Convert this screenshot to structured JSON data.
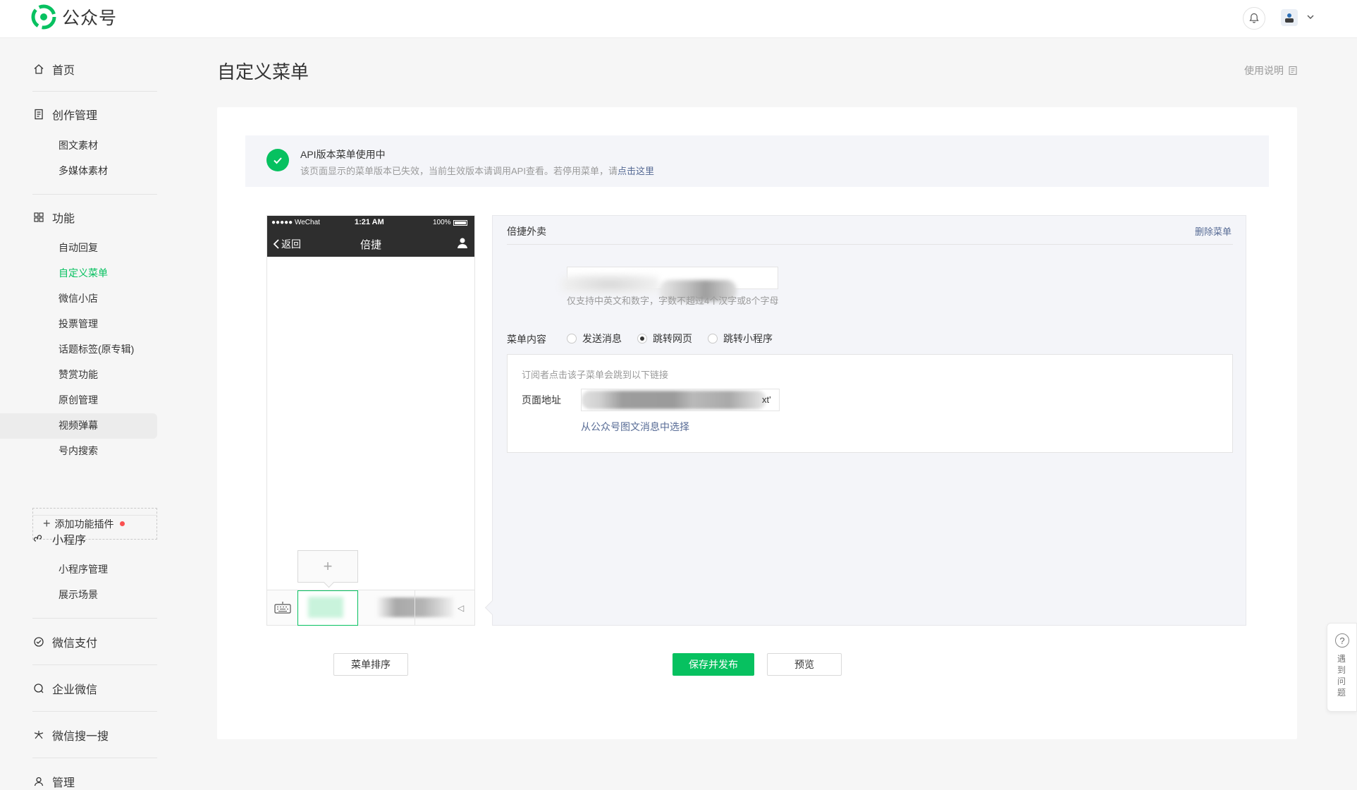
{
  "app": {
    "brand": "公众号"
  },
  "sidebar": {
    "home": "首页",
    "creation": {
      "label": "创作管理",
      "items": [
        "图文素材",
        "多媒体素材"
      ]
    },
    "functions": {
      "label": "功能",
      "items": [
        "自动回复",
        "自定义菜单",
        "微信小店",
        "投票管理",
        "话题标签(原专辑)",
        "赞赏功能",
        "原创管理",
        "视频弹幕",
        "号内搜索"
      ],
      "active_index": 1
    },
    "add_plugin": "添加功能插件",
    "miniprogram": {
      "label": "小程序",
      "items": [
        "小程序管理",
        "展示场景"
      ]
    },
    "pay": "微信支付",
    "work": "企业微信",
    "search": "微信搜一搜",
    "manage": "管理"
  },
  "main": {
    "title": "自定义菜单",
    "help": "使用说明",
    "notice": {
      "title": "API版本菜单使用中",
      "desc": "该页面显示的菜单版本已失效，当前生效版本请调用API查看。若停用菜单，请",
      "link": "点击这里"
    },
    "phone": {
      "signal": "●●●●● WeChat",
      "time": "1:21 AM",
      "battery": "100%",
      "back": "返回",
      "title": "倍捷",
      "add_symbol": "+"
    },
    "editor": {
      "menu_name": "倍捷外卖",
      "delete": "删除菜单",
      "name_hint": "仅支持中英文和数字，字数不超过4个汉字或8个字母",
      "content_label": "菜单内容",
      "options": [
        "发送消息",
        "跳转网页",
        "跳转小程序"
      ],
      "selected_option": "跳转网页",
      "url_desc": "订阅者点击该子菜单会跳到以下链接",
      "url_label": "页面地址",
      "url_tail": "xt'",
      "url_pick": "从公众号图文消息中选择"
    },
    "buttons": {
      "sort": "菜单排序",
      "save": "保存并发布",
      "preview": "预览"
    }
  },
  "float_help": {
    "symbol": "?",
    "text": "遇到问题"
  },
  "colors": {
    "accent": "#07c160",
    "link": "#576b95",
    "danger": "#fa5151"
  }
}
